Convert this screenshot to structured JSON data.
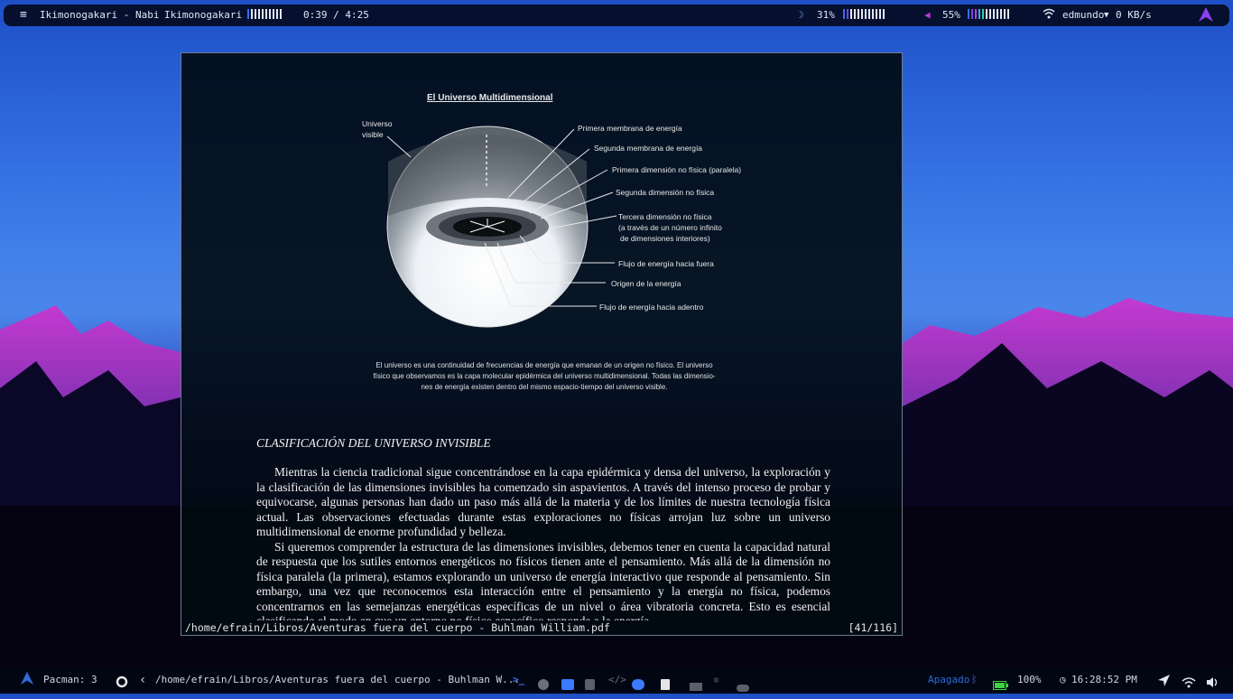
{
  "topbar": {
    "song": "Ikimonogakari - Nabi",
    "artist": "Ikimonogakari",
    "time": "0:39 / 4:25",
    "brightness": "31%",
    "volume": "55%",
    "user": "edmundo",
    "net": "0 KB/s"
  },
  "figure": {
    "title": "El Universo Multidimensional",
    "labels": {
      "visible_1": "Universo",
      "visible_2": "visible",
      "l1": "Primera membrana de energía",
      "l2": "Segunda membrana de energía",
      "l3": "Primera dimensión no física (paralela)",
      "l4": "Segunda dimensión no física",
      "l5a": "Tercera dimensión no física",
      "l5b": "(a través de un número infinito",
      "l5c": "de dimensiones interiores)",
      "l6": "Flujo de energía hacia fuera",
      "l7": "Origen de la energía",
      "l8": "Flujo de energía hacia adentro"
    },
    "caption_1": "El universo es una continuidad de frecuencias de energía que emanan de un origen no físico. El universo",
    "caption_2": "físico que observamos es la capa molecular epidérmica del universo multidimensional. Todas las dimensio-",
    "caption_3": "nes de energía existen dentro del mismo espacio-tiempo del universo visible."
  },
  "document": {
    "section_title": "CLASIFICACIÓN DEL UNIVERSO INVISIBLE",
    "p1": "Mientras la ciencia tradicional sigue concentrándose en la capa epidérmica y densa del universo, la exploración y la clasificación de las dimensiones invisibles ha comenzado sin aspavientos. A través del intenso proceso de probar y equivocarse, algunas personas han dado un paso más allá de la materia y de los límites de nuestra tecnología física actual. Las observaciones efectuadas durante estas exploraciones no físicas arrojan luz sobre un universo multidimensional de enorme profundidad y belleza.",
    "p2": "Si queremos comprender la estructura de las dimensiones invisibles, debemos tener en cuenta la capacidad natural de respuesta que los sutiles entornos energéticos no físicos tienen ante el pensamiento. Más allá de la dimensión no física paralela (la primera), estamos explorando un universo de energía interactivo que responde al pensamiento. Sin embargo, una vez que reconocemos esta interacción entre el pensamiento y la energía no física, podemos concentrarnos en las semejanzas energéticas específicas de un nivel o área vibratoria concreta. Esto es esencial clasificando el modo en que un entorno no físico específico responde a la energía"
  },
  "statusline": {
    "path": "/home/efrain/Libros/Aventuras fuera del cuerpo - Buhlman William.pdf",
    "page": "[41/116]"
  },
  "bottombar": {
    "pacman": "Pacman: 3",
    "window_title": "/home/efrain/Libros/Aventuras fuera del cuerpo - Buhlman W...",
    "bluetooth": "Apagado",
    "battery": "100%",
    "clock": "16:28:52 PM"
  },
  "colors": {
    "accent": "#7b3fe4",
    "bar_blue": "#3a6bff",
    "bluetooth": "#2f6bd8",
    "battery": "#3fd13f"
  }
}
